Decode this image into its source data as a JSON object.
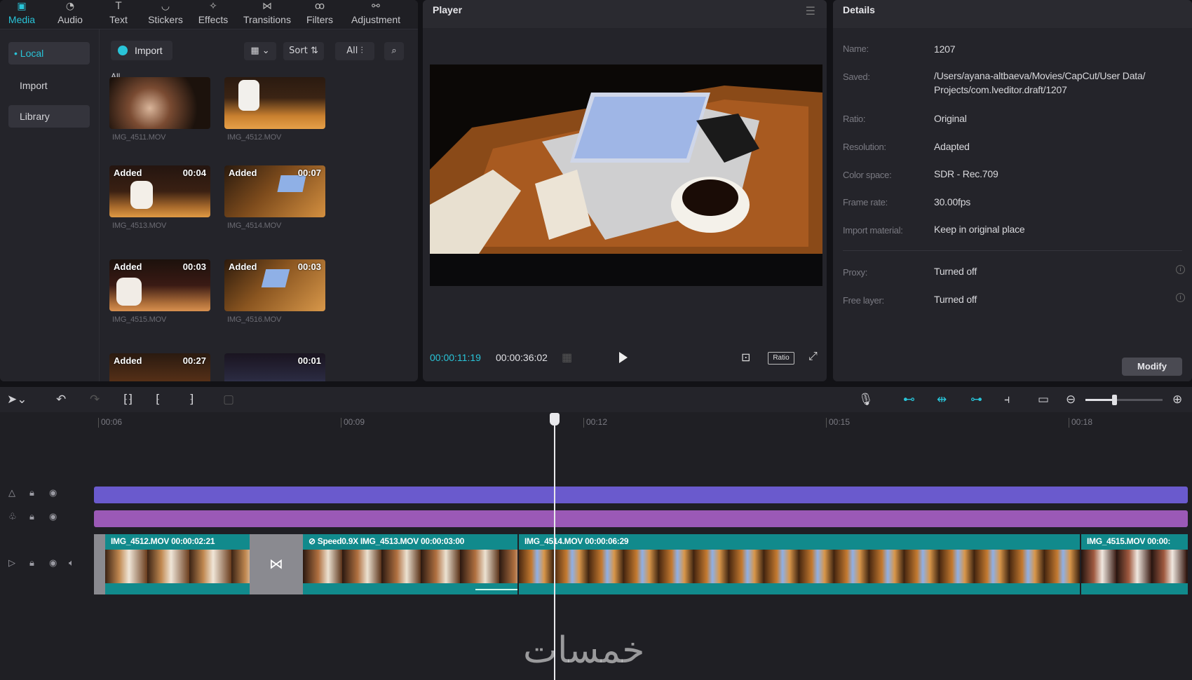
{
  "top_tabs": [
    {
      "label": "Media",
      "icon": "media-icon"
    },
    {
      "label": "Audio",
      "icon": "audio-icon"
    },
    {
      "label": "Text",
      "icon": "text-icon"
    },
    {
      "label": "Stickers",
      "icon": "stickers-icon"
    },
    {
      "label": "Effects",
      "icon": "effects-icon"
    },
    {
      "label": "Transitions",
      "icon": "transitions-icon"
    },
    {
      "label": "Filters",
      "icon": "filters-icon"
    },
    {
      "label": "Adjustment",
      "icon": "adjustment-icon"
    }
  ],
  "sidebar": {
    "items": [
      {
        "label": "• Local"
      },
      {
        "label": "Import"
      },
      {
        "label": "Library"
      }
    ]
  },
  "media_toolbar": {
    "import_label": "Import",
    "sort_label": "Sort",
    "all_label": "All"
  },
  "media_grid": {
    "section_label": "All",
    "items": [
      {
        "name": "IMG_4511.MOV",
        "badge": "",
        "duration": ""
      },
      {
        "name": "IMG_4512.MOV",
        "badge": "",
        "duration": ""
      },
      {
        "name": "IMG_4513.MOV",
        "badge": "Added",
        "duration": "00:04"
      },
      {
        "name": "IMG_4514.MOV",
        "badge": "Added",
        "duration": "00:07"
      },
      {
        "name": "IMG_4515.MOV",
        "badge": "Added",
        "duration": "00:03"
      },
      {
        "name": "IMG_4516.MOV",
        "badge": "Added",
        "duration": "00:03"
      },
      {
        "name": "",
        "badge": "Added",
        "duration": "00:27"
      },
      {
        "name": "",
        "badge": "",
        "duration": "00:01"
      }
    ]
  },
  "player": {
    "title": "Player",
    "current_time": "00:00:11:19",
    "total_time": "00:00:36:02",
    "ratio_label": "Ratio"
  },
  "details": {
    "title": "Details",
    "rows": [
      {
        "key": "Name:",
        "value": "1207"
      },
      {
        "key": "Saved:",
        "value": "/Users/ayana-altbaeva/Movies/CapCut/User Data/ Projects/com.lveditor.draft/1207"
      },
      {
        "key": "Ratio:",
        "value": "Original"
      },
      {
        "key": "Resolution:",
        "value": "Adapted"
      },
      {
        "key": "Color space:",
        "value": "SDR - Rec.709"
      },
      {
        "key": "Frame rate:",
        "value": "30.00fps"
      },
      {
        "key": "Import material:",
        "value": "Keep in original place"
      },
      {
        "key": "Proxy:",
        "value": "Turned off"
      },
      {
        "key": "Free layer:",
        "value": "Turned off"
      }
    ],
    "modify_label": "Modify"
  },
  "timeline": {
    "ruler_ticks": [
      "00:06",
      "00:09",
      "00:12",
      "00:15",
      "00:18"
    ],
    "clips": [
      {
        "label": "IMG_4512.MOV   00:00:02:21"
      },
      {
        "label": "⊘ Speed0.9X  IMG_4513.MOV   00:00:03:00"
      },
      {
        "label": "IMG_4514.MOV   00:00:06:29"
      },
      {
        "label": "IMG_4515.MOV   00:00:"
      }
    ],
    "colors": {
      "track_purple": "#6a5acd",
      "track_pink": "#9b59b6",
      "clip_teal": "#118a8c",
      "accent": "#29c4d8"
    }
  },
  "watermark": "خمسات"
}
